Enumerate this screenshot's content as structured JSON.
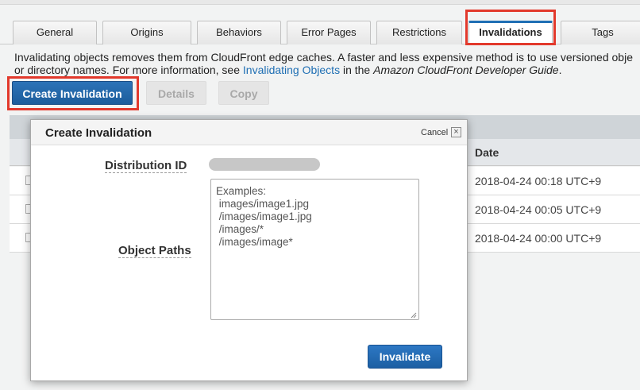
{
  "tabs": [
    {
      "label": "General"
    },
    {
      "label": "Origins"
    },
    {
      "label": "Behaviors"
    },
    {
      "label": "Error Pages"
    },
    {
      "label": "Restrictions"
    },
    {
      "label": "Invalidations"
    },
    {
      "label": "Tags"
    }
  ],
  "active_tab": "Invalidations",
  "description": {
    "line1": "Invalidating objects removes them from CloudFront edge caches. A faster and less expensive method is to use versioned obje",
    "line2_prefix": "or directory names. For more information, see ",
    "link_text": "Invalidating Objects",
    "line2_middle": " in the ",
    "guide_title": "Amazon CloudFront Developer Guide",
    "line2_suffix": "."
  },
  "toolbar": {
    "create_label": "Create Invalidation",
    "details_label": "Details",
    "copy_label": "Copy"
  },
  "table": {
    "date_header": "Date",
    "rows": [
      {
        "date": "2018-04-24 00:18 UTC+9"
      },
      {
        "date": "2018-04-24 00:05 UTC+9"
      },
      {
        "date": "2018-04-24 00:00 UTC+9"
      }
    ]
  },
  "modal": {
    "title": "Create Invalidation",
    "cancel_label": "Cancel",
    "close_glyph": "×",
    "distribution_id_label": "Distribution ID",
    "object_paths_label": "Object Paths",
    "object_paths_placeholder": "Examples:\n images/image1.jpg\n /images/image1.jpg\n /images/*\n /images/image*",
    "invalidate_label": "Invalidate"
  },
  "colors": {
    "accent": "#1f6fb4",
    "highlight": "#e2392c",
    "primary_button": "#1c5d9c"
  }
}
